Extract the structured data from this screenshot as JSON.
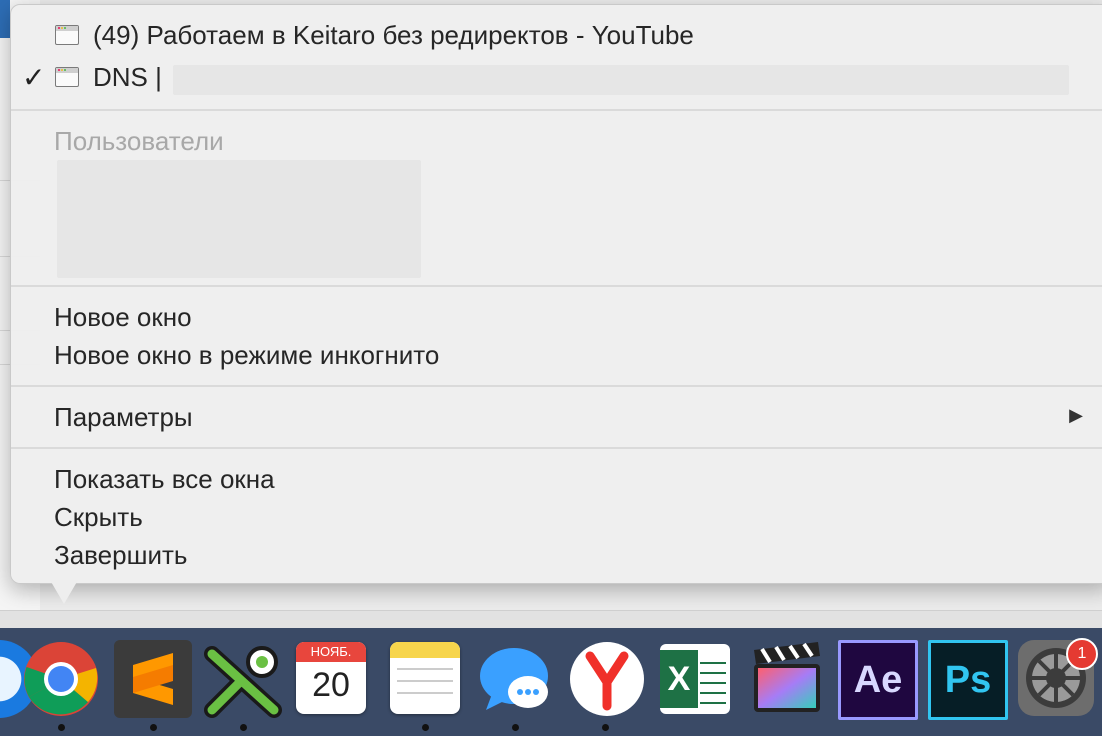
{
  "menu": {
    "windows": [
      {
        "title": "(49) Работаем в Keitaro без редиректов - YouTube",
        "checked": false
      },
      {
        "title": "DNS |",
        "checked": true
      }
    ],
    "users_header": "Пользователи",
    "new_window": "Новое окно",
    "new_incognito": "Новое окно в режиме инкогнито",
    "parameters": "Параметры",
    "submenu_arrow": "▶",
    "show_all": "Показать все окна",
    "hide": "Скрыть",
    "quit": "Завершить",
    "check_mark": "✓"
  },
  "dock": {
    "apps": [
      {
        "name": "Chrome",
        "icon": "chrome-icon",
        "running": true
      },
      {
        "name": "Sublime Text",
        "icon": "sublime-icon",
        "running": true
      },
      {
        "name": "KeePassXC",
        "icon": "key-icon",
        "running": true
      },
      {
        "name": "Calendar",
        "icon": "calendar-icon",
        "month": "НОЯБ.",
        "day": "20",
        "running": false
      },
      {
        "name": "Notes",
        "icon": "notes-icon",
        "running": true
      },
      {
        "name": "Messages",
        "icon": "messages-icon",
        "running": true
      },
      {
        "name": "Yandex Browser",
        "icon": "yandex-icon",
        "running": true
      },
      {
        "name": "Excel",
        "icon": "excel-icon",
        "label": "X",
        "running": false
      },
      {
        "name": "Final Cut Pro",
        "icon": "clapper-icon",
        "running": false
      },
      {
        "name": "After Effects",
        "icon": "after-effects-icon",
        "label": "Ae",
        "running": false
      },
      {
        "name": "Photoshop",
        "icon": "photoshop-icon",
        "label": "Ps",
        "running": false
      },
      {
        "name": "System Preferences",
        "icon": "gear-icon",
        "badge": "1",
        "running": false
      }
    ]
  },
  "colors": {
    "menu_bg": "#eeeeee",
    "text": "#262626",
    "disabled": "#a8a8a8",
    "dock_bg": "#3a4a66"
  }
}
